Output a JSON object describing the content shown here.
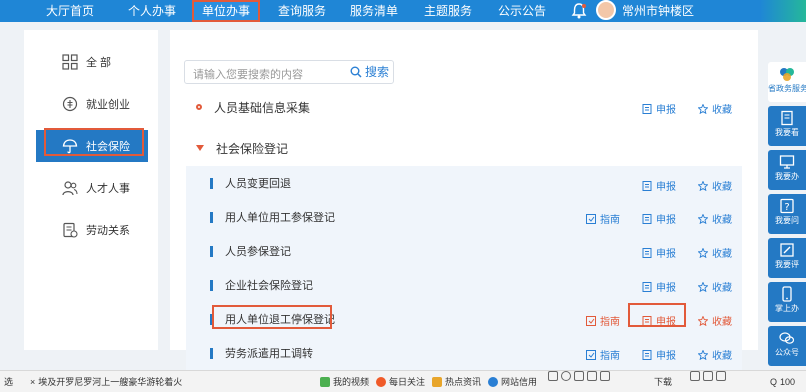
{
  "nav": {
    "items": [
      "大厅首页",
      "个人办事",
      "单位办事",
      "查询服务",
      "服务清单",
      "主题服务",
      "公示公告"
    ],
    "active_index": 2,
    "user": "常州市钟楼区"
  },
  "categories": [
    {
      "label": "全 部",
      "icon": "grid-icon"
    },
    {
      "label": "就业创业",
      "icon": "coin-icon"
    },
    {
      "label": "社会保险",
      "icon": "umbrella-icon"
    },
    {
      "label": "人才人事",
      "icon": "people-icon"
    },
    {
      "label": "劳动关系",
      "icon": "document-icon"
    }
  ],
  "search": {
    "placeholder": "请输入您要搜索的内容",
    "button": "搜索"
  },
  "actions": {
    "apply": "申报",
    "favorite": "收藏",
    "guide": "指南"
  },
  "groups": [
    {
      "label": "人员基础信息采集"
    },
    {
      "label": "社会保险登记"
    }
  ],
  "items": [
    {
      "label": "人员变更回退",
      "guide": false
    },
    {
      "label": "用人单位用工参保登记",
      "guide": true
    },
    {
      "label": "人员参保登记",
      "guide": false
    },
    {
      "label": "企业社会保险登记",
      "guide": false
    },
    {
      "label": "用人单位退工停保登记",
      "guide": true
    },
    {
      "label": "劳务派遣用工调转",
      "guide": true
    }
  ],
  "sidebar": [
    "省政务服务",
    "我要看",
    "我要办",
    "我要问",
    "我要评",
    "掌上办",
    "公众号"
  ],
  "statusbar": {
    "left": "选",
    "news": "埃及开罗尼罗河上一艘豪华游轮着火",
    "items": [
      "我的视频",
      "每日关注",
      "热点资讯",
      "网站信用"
    ],
    "download": "下载",
    "zoom": "100"
  },
  "colors": {
    "primary": "#2479c4",
    "accent": "#e25a3a",
    "nav": "#1f86d6"
  }
}
